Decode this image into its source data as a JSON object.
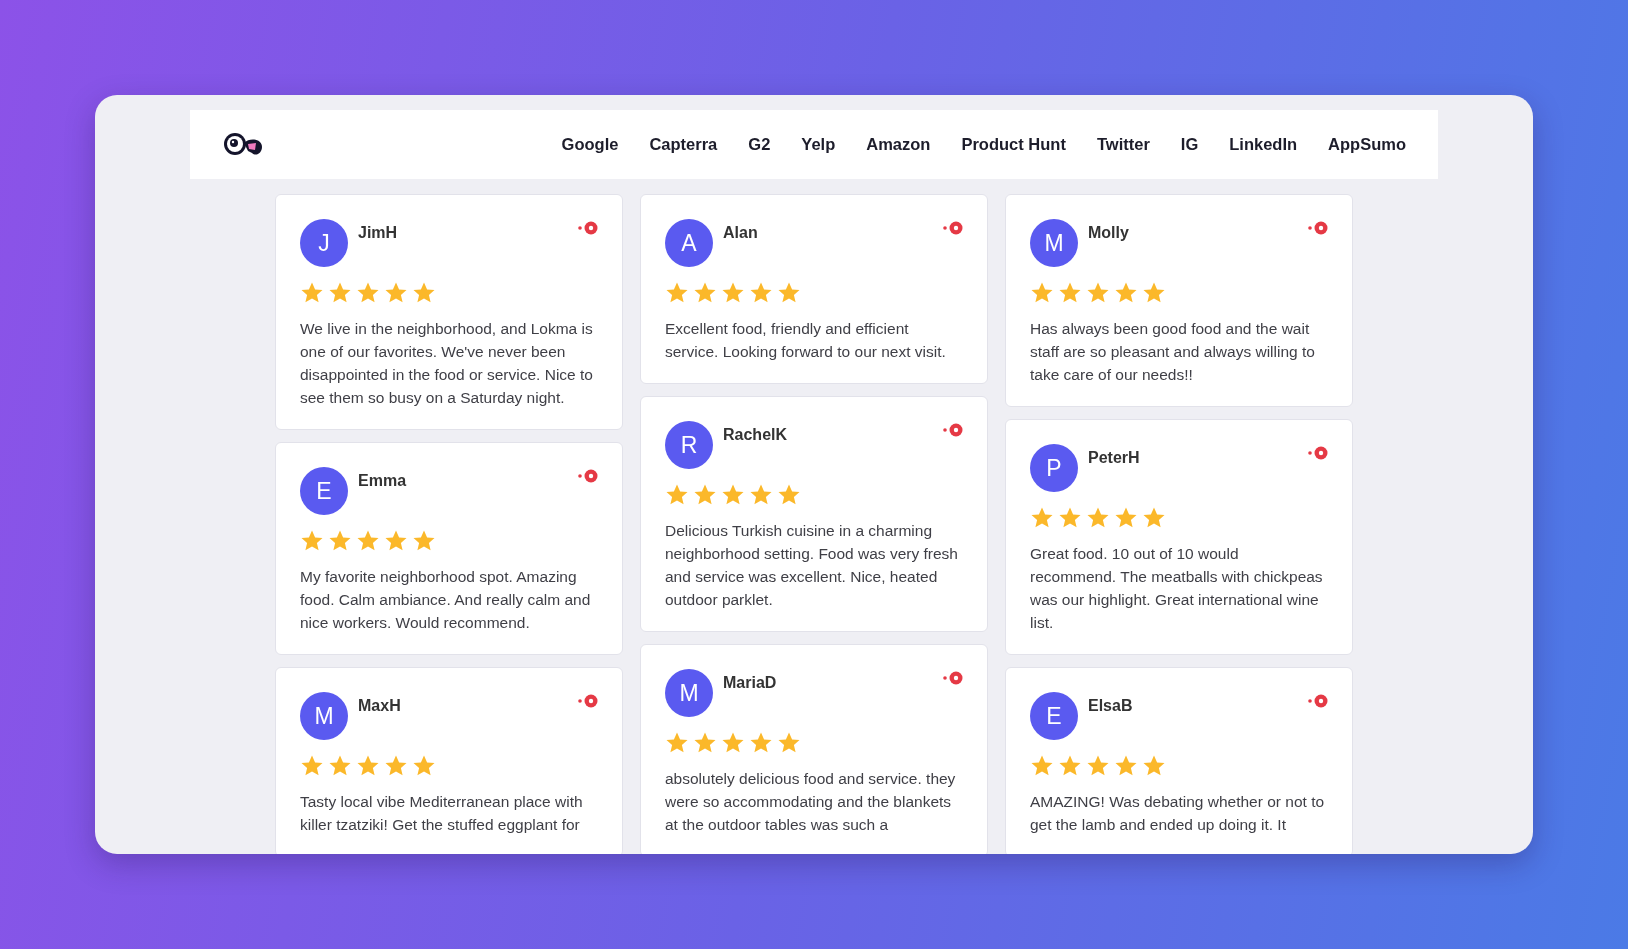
{
  "nav": [
    {
      "label": "Google"
    },
    {
      "label": "Capterra"
    },
    {
      "label": "G2"
    },
    {
      "label": "Yelp"
    },
    {
      "label": "Amazon"
    },
    {
      "label": "Product Hunt"
    },
    {
      "label": "Twitter"
    },
    {
      "label": "IG"
    },
    {
      "label": "LinkedIn"
    },
    {
      "label": "AppSumo"
    }
  ],
  "columns": [
    [
      {
        "initial": "J",
        "name": "JimH",
        "stars": 5,
        "text": "We live in the neighborhood, and Lokma is one of our favorites. We've never been disappointed in the food or service. Nice to see them so busy on a Saturday night."
      },
      {
        "initial": "E",
        "name": "Emma",
        "stars": 5,
        "text": "My favorite neighborhood spot. Amazing food. Calm ambiance. And really calm and nice workers. Would recommend."
      },
      {
        "initial": "M",
        "name": "MaxH",
        "stars": 5,
        "text": "Tasty local vibe Mediterranean place with killer tzatziki! Get the stuffed eggplant for"
      }
    ],
    [
      {
        "initial": "A",
        "name": "Alan",
        "stars": 5,
        "text": "Excellent food, friendly and efficient service. Looking forward to our next visit."
      },
      {
        "initial": "R",
        "name": "RachelK",
        "stars": 5,
        "text": "Delicious Turkish cuisine in a charming neighborhood setting. Food was very fresh and service was excellent. Nice, heated outdoor parklet."
      },
      {
        "initial": "M",
        "name": "MariaD",
        "stars": 5,
        "text": "absolutely delicious food and service. they were so accommodating and the blankets at the outdoor tables was such a"
      }
    ],
    [
      {
        "initial": "M",
        "name": "Molly",
        "stars": 5,
        "text": "Has always been good food and the wait staff are so pleasant and always willing to take care of our needs!!"
      },
      {
        "initial": "P",
        "name": "PeterH",
        "stars": 5,
        "text": "Great food. 10 out of 10 would recommend. The meatballs with chickpeas was our highlight. Great international wine list."
      },
      {
        "initial": "E",
        "name": "ElsaB",
        "stars": 5,
        "text": "AMAZING! Was debating whether or not to get the lamb and ended up doing it. It"
      }
    ]
  ]
}
